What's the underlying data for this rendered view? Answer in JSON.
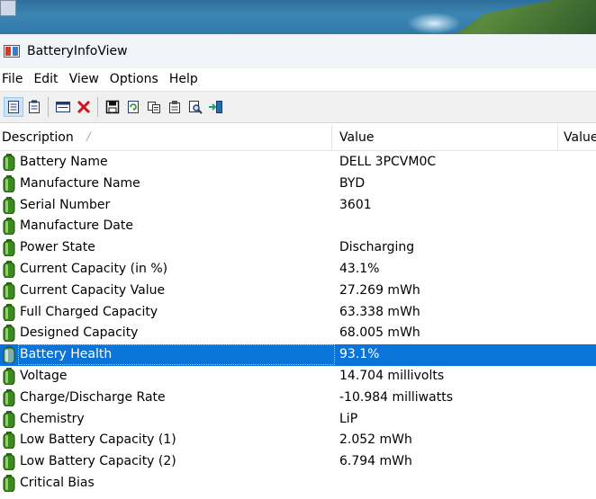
{
  "window": {
    "title": "BatteryInfoView"
  },
  "menu": [
    "File",
    "Edit",
    "View",
    "Options",
    "Help"
  ],
  "toolbar": {
    "buttons": [
      {
        "icon": "properties-list-icon"
      },
      {
        "icon": "report-icon"
      },
      {
        "icon": "window-icon"
      },
      {
        "icon": "delete-x-icon"
      },
      {
        "icon": "save-icon"
      },
      {
        "icon": "refresh-icon"
      },
      {
        "icon": "copy-icon"
      },
      {
        "icon": "properties-icon"
      },
      {
        "icon": "find-icon"
      },
      {
        "icon": "exit-icon"
      }
    ]
  },
  "columns": {
    "description": "Description",
    "value": "Value",
    "value2": "Value"
  },
  "rows": [
    {
      "description": "Battery Name",
      "value": "DELL 3PCVM0C"
    },
    {
      "description": "Manufacture Name",
      "value": "BYD"
    },
    {
      "description": "Serial Number",
      "value": "3601"
    },
    {
      "description": "Manufacture Date",
      "value": ""
    },
    {
      "description": "Power State",
      "value": "Discharging"
    },
    {
      "description": "Current Capacity (in %)",
      "value": "43.1%"
    },
    {
      "description": "Current Capacity Value",
      "value": "27.269 mWh"
    },
    {
      "description": "Full Charged Capacity",
      "value": "63.338 mWh"
    },
    {
      "description": "Designed Capacity",
      "value": "68.005 mWh"
    },
    {
      "description": "Battery Health",
      "value": "93.1%",
      "selected": true
    },
    {
      "description": "Voltage",
      "value": "14.704 millivolts"
    },
    {
      "description": "Charge/Discharge Rate",
      "value": "-10.984 milliwatts"
    },
    {
      "description": "Chemistry",
      "value": "LiP"
    },
    {
      "description": "Low Battery Capacity (1)",
      "value": "2.052 mWh"
    },
    {
      "description": "Low Battery Capacity (2)",
      "value": "6.794 mWh"
    },
    {
      "description": "Critical Bias",
      "value": ""
    }
  ],
  "colors": {
    "selection": "#0a74da",
    "battery_green": "#3a8a1e"
  }
}
